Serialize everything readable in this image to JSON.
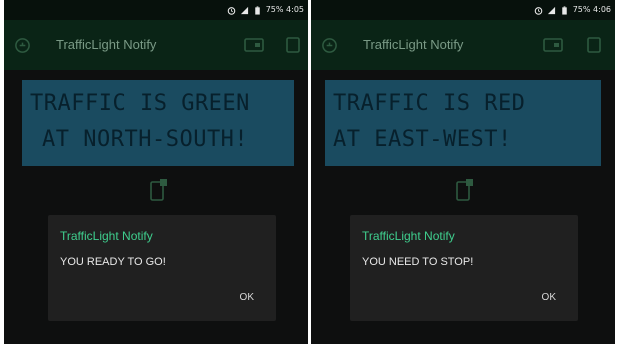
{
  "colors": {
    "app_bar": "#0a2416",
    "app_title": "#7a9a86",
    "lcd_background": "#1a4b60",
    "lcd_text": "#07202c",
    "dialog_background": "#202020",
    "dialog_title": "#3fcf8e",
    "dialog_text": "#e8e8e8"
  },
  "screens": [
    {
      "status_bar": {
        "battery_time": "75% 4:05",
        "icons": [
          "alarm-icon",
          "signal-icon",
          "battery-icon"
        ]
      },
      "app_bar": {
        "title": "TrafficLight Notify",
        "icons": [
          "app-logo-icon",
          "device-screen-icon",
          "square-icon"
        ]
      },
      "lcd": {
        "line1": "TRAFFIC IS GREEN",
        "line2": "AT NORTH-SOUTH!"
      },
      "notification_icon": "phone-notification-icon",
      "dialog": {
        "title": "TrafficLight Notify",
        "message": "YOU READY TO GO!",
        "ok_label": "OK"
      }
    },
    {
      "status_bar": {
        "battery_time": "75% 4:06",
        "icons": [
          "alarm-icon",
          "signal-icon",
          "battery-icon"
        ]
      },
      "app_bar": {
        "title": "TrafficLight Notify",
        "icons": [
          "app-logo-icon",
          "device-screen-icon",
          "square-icon"
        ]
      },
      "lcd": {
        "line1": "TRAFFIC IS RED",
        "line2": "AT EAST-WEST!"
      },
      "notification_icon": "phone-notification-icon",
      "dialog": {
        "title": "TrafficLight Notify",
        "message": "YOU NEED TO STOP!",
        "ok_label": "OK"
      }
    }
  ]
}
